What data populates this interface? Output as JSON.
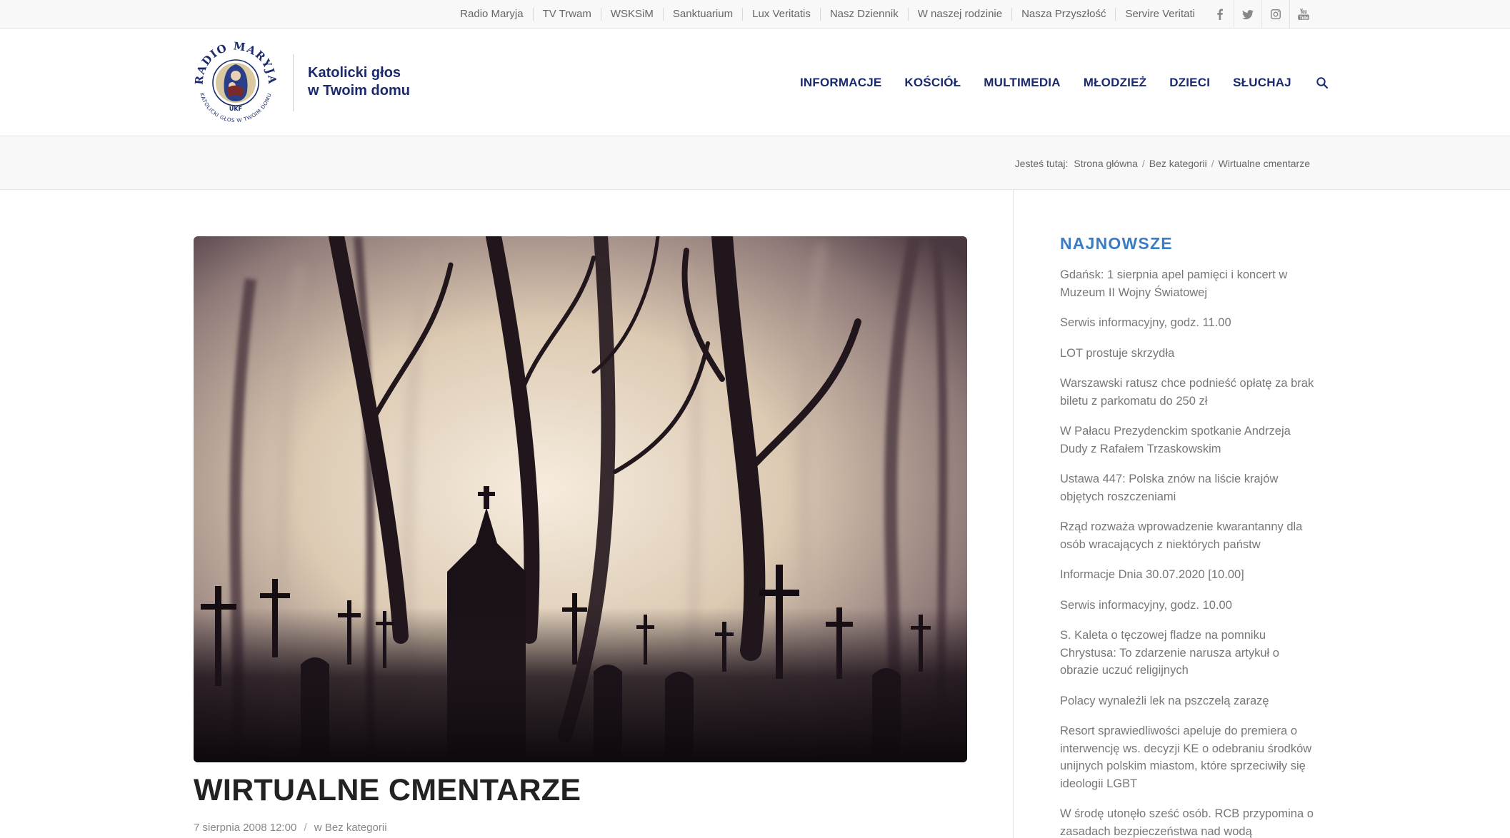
{
  "topbar": {
    "links": [
      "Radio Maryja",
      "TV Trwam",
      "WSKSiM",
      "Sanktuarium",
      "Lux Veritatis",
      "Nasz Dziennik",
      "W naszej rodzinie",
      "Nasza Przyszłość",
      "Servire Veritati"
    ],
    "social_icons": [
      "facebook-icon",
      "twitter-icon",
      "instagram-icon",
      "youtube-icon"
    ]
  },
  "header": {
    "logo_text_top": "RADIO MARYJA",
    "logo_text_bottom": "KATOLICKI GŁOS W TWOIM DOMU",
    "logo_badge": "UKF",
    "tagline_line1": "Katolicki głos",
    "tagline_line2": "w Twoim domu",
    "nav": [
      "INFORMACJE",
      "KOŚCIÓŁ",
      "MULTIMEDIA",
      "MŁODZIEŻ",
      "DZIECI",
      "SŁUCHAJ"
    ],
    "search_icon": "search-icon"
  },
  "breadcrumb": {
    "label": "Jesteś tutaj:",
    "items": [
      "Strona główna",
      "Bez kategorii",
      "Wirtualne cmentarze"
    ]
  },
  "post": {
    "title": "WIRTUALNE CMENTARZE",
    "date": "7 sierpnia 2008 12:00",
    "category_prefix": "w",
    "category": "Bez kategorii"
  },
  "sidebar": {
    "title": "NAJNOWSZE",
    "items": [
      "Gdańsk: 1 sierpnia apel pamięci i koncert w Muzeum II Wojny Światowej",
      "Serwis informacyjny, godz. 11.00",
      "LOT prostuje skrzydła",
      "Warszawski ratusz chce podnieść opłatę za brak biletu z parkomatu do 250 zł",
      "W Pałacu Prezydenckim spotkanie Andrzeja Dudy z Rafałem Trzaskowskim",
      "Ustawa 447: Polska znów na liście krajów objętych roszczeniami",
      "Rząd rozważa wprowadzenie kwarantanny dla osób wracających z niektórych państw",
      "Informacje Dnia 30.07.2020 [10.00]",
      "Serwis informacyjny, godz. 10.00",
      "S. Kaleta o tęczowej fladze na pomniku Chrystusa: To zdarzenie narusza artykuł o obrazie uczuć religijnych",
      "Polacy wynaleźli lek na pszczelą zarazę",
      "Resort sprawiedliwości apeluje do premiera o interwencję ws. decyzji KE o odebraniu środków unijnych polskim miastom, które sprzeciwiły się ideologii LGBT",
      "W środę utonęło sześć osób. RCB przypomina o zasadach bezpieczeństwa nad wodą"
    ]
  },
  "colors": {
    "brand_navy": "#1a2a6c",
    "widget_blue": "#3b7dc4",
    "body_text": "#666666"
  }
}
